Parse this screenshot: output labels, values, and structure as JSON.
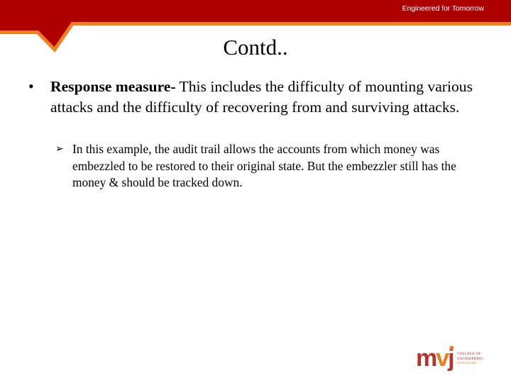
{
  "header": {
    "tagline": "Engineered for Tomorrow",
    "banner_color": "#AE0000",
    "accent_color": "#F0801E"
  },
  "slide": {
    "title": "Contd..",
    "bullets": [
      {
        "glyph": "•",
        "bold_lead": "Response measure-",
        "text": " This includes the difficulty of mounting various attacks and the difficulty of recovering from and surviving attacks.",
        "sub_bullets": [
          {
            "glyph": "➢",
            "text": "In this example, the audit trail allows the accounts from which money was embezzled to be restored to their original state. But the embezzler still has the money & should be tracked down."
          }
        ]
      }
    ]
  },
  "logo": {
    "letters": [
      "m",
      "v",
      "j"
    ],
    "line1": "COLLEGE OF",
    "line2": "ENGINEERING",
    "line3": "BANGALORE"
  }
}
